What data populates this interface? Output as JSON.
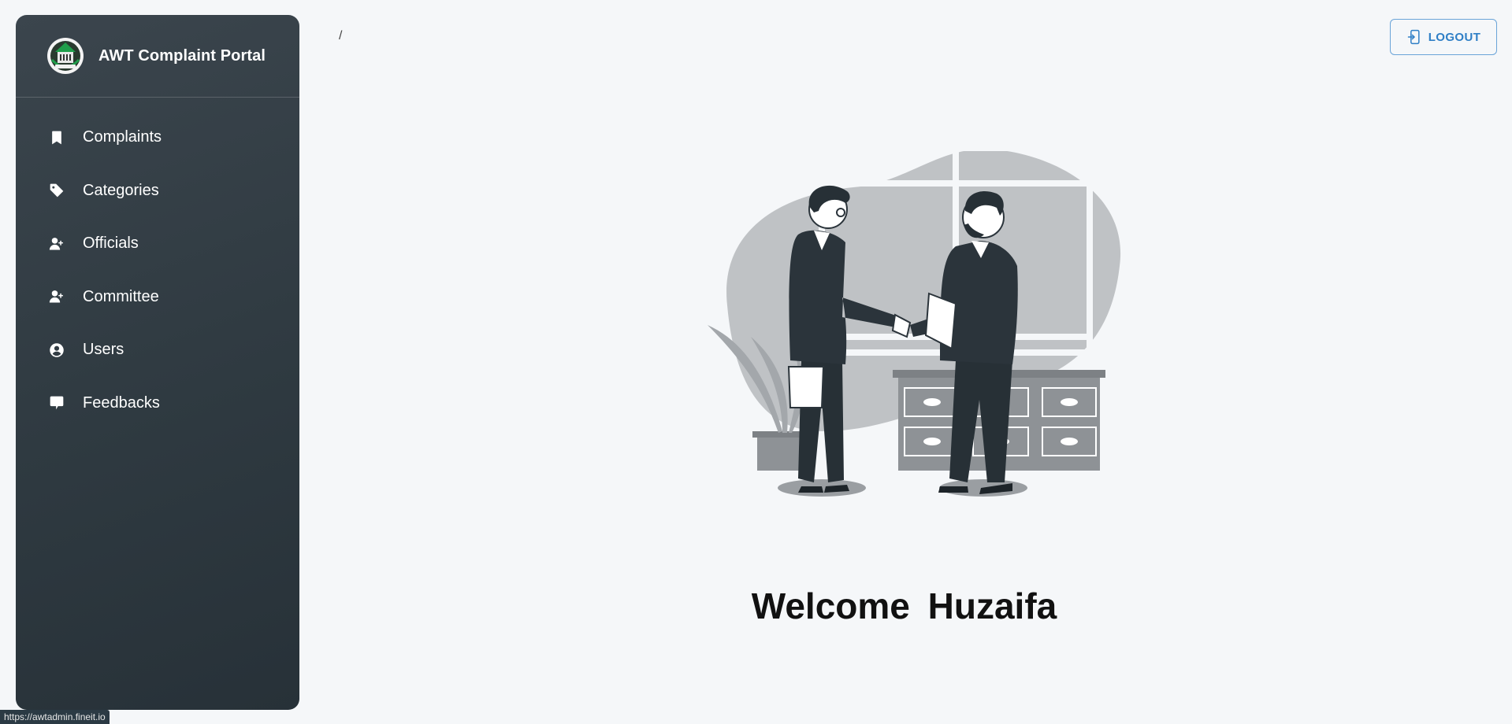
{
  "app": {
    "title": "AWT Complaint Portal"
  },
  "sidebar": {
    "items": [
      {
        "label": "Complaints",
        "icon": "bookmark-icon"
      },
      {
        "label": "Categories",
        "icon": "tag-icon"
      },
      {
        "label": "Officials",
        "icon": "user-plus-icon"
      },
      {
        "label": "Committee",
        "icon": "user-plus-icon"
      },
      {
        "label": "Users",
        "icon": "user-circle-icon"
      },
      {
        "label": "Feedbacks",
        "icon": "chat-bubble-icon"
      }
    ]
  },
  "header": {
    "breadcrumb": "/",
    "logout_label": "LOGOUT"
  },
  "main": {
    "welcome_word": "Welcome",
    "user_name": "Huzaifa"
  },
  "status_bar": {
    "url": "https://awtadmin.fineit.io"
  },
  "colors": {
    "sidebar_bg": "#343e46",
    "accent": "#2f7fc6",
    "page_bg": "#f5f7f9"
  }
}
